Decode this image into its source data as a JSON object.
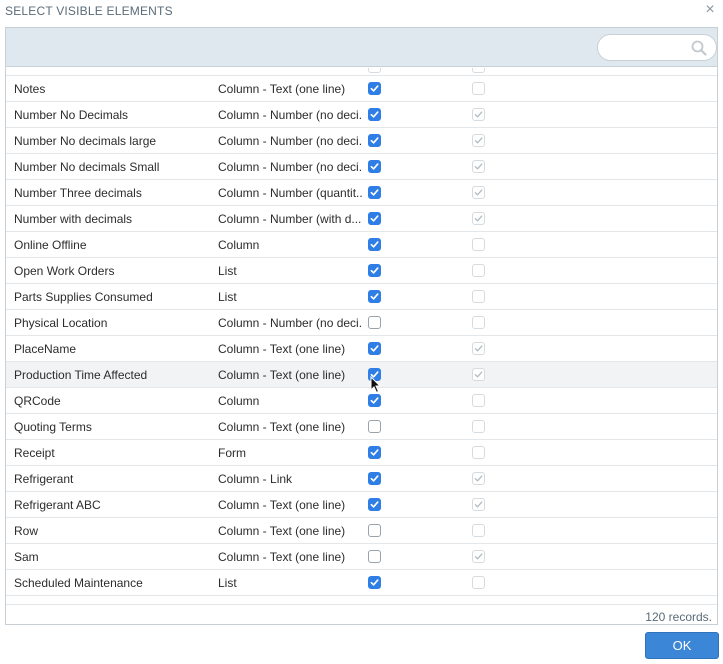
{
  "dialog": {
    "title": "SELECT VISIBLE ELEMENTS",
    "close_glyph": "×"
  },
  "search": {
    "placeholder": "",
    "value": "",
    "icon": "search-icon"
  },
  "rows": [
    {
      "name": "Notes",
      "type": "Column - Text (one line)",
      "visible": true,
      "second": false
    },
    {
      "name": "Number No Decimals",
      "type": "Column - Number (no deci...",
      "visible": true,
      "second": true
    },
    {
      "name": "Number No decimals large",
      "type": "Column - Number (no deci...",
      "visible": true,
      "second": true
    },
    {
      "name": "Number No decimals Small",
      "type": "Column - Number (no deci...",
      "visible": true,
      "second": true
    },
    {
      "name": "Number Three decimals",
      "type": "Column - Number (quantit...",
      "visible": true,
      "second": true
    },
    {
      "name": "Number with decimals",
      "type": "Column - Number (with d...",
      "visible": true,
      "second": true
    },
    {
      "name": "Online Offline",
      "type": "Column",
      "visible": true,
      "second": false
    },
    {
      "name": "Open Work Orders",
      "type": "List",
      "visible": true,
      "second": false
    },
    {
      "name": "Parts Supplies Consumed",
      "type": "List",
      "visible": true,
      "second": false
    },
    {
      "name": "Physical Location",
      "type": "Column - Number (no deci...",
      "visible": false,
      "second": false
    },
    {
      "name": "PlaceName",
      "type": "Column - Text (one line)",
      "visible": true,
      "second": true
    },
    {
      "name": "Production Time Affected",
      "type": "Column - Text (one line)",
      "visible": true,
      "second": true
    },
    {
      "name": "QRCode",
      "type": "Column",
      "visible": true,
      "second": false
    },
    {
      "name": "Quoting Terms",
      "type": "Column - Text (one line)",
      "visible": false,
      "second": false
    },
    {
      "name": "Receipt",
      "type": "Form",
      "visible": true,
      "second": false
    },
    {
      "name": "Refrigerant",
      "type": "Column - Link",
      "visible": true,
      "second": true
    },
    {
      "name": "Refrigerant ABC",
      "type": "Column - Text (one line)",
      "visible": true,
      "second": true
    },
    {
      "name": "Row",
      "type": "Column - Text (one line)",
      "visible": false,
      "second": false
    },
    {
      "name": "Sam",
      "type": "Column - Text (one line)",
      "visible": false,
      "second": true
    },
    {
      "name": "Scheduled Maintenance",
      "type": "List",
      "visible": true,
      "second": false
    }
  ],
  "hovered_row_index": 11,
  "footer": {
    "records": "120 records."
  },
  "ok_button": {
    "label": "OK"
  },
  "colors": {
    "accent": "#2f7ee6",
    "header_bg": "#dfe7ef",
    "ok_bg": "#3b86d6"
  }
}
